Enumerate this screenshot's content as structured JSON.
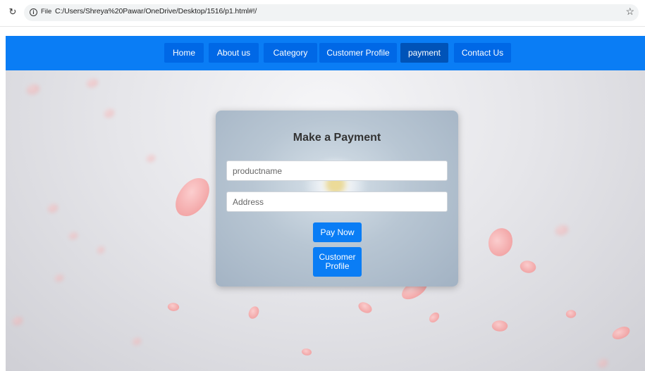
{
  "browser": {
    "scheme_label": "File",
    "url": "C:/Users/Shreya%20Pawar/OneDrive/Desktop/1516/p1.html#!/",
    "reload_icon": "reload-icon",
    "bookmark_icon": "star-icon"
  },
  "nav": {
    "items": [
      {
        "label": "Home"
      },
      {
        "label": "About us"
      },
      {
        "label": "Category"
      },
      {
        "label": "Customer Profile"
      },
      {
        "label": "payment"
      },
      {
        "label": "Contact Us"
      }
    ],
    "active": "payment",
    "bar_color": "#0a7df5",
    "item_color": "#0068e6",
    "active_color": "#0053b8"
  },
  "form": {
    "title": "Make a Payment",
    "product_placeholder": "productname",
    "address_placeholder": "Address",
    "pay_label": "Pay Now",
    "profile_label_line1": "Customer",
    "profile_label_line2": "Profile",
    "button_color": "#0a7df5"
  }
}
